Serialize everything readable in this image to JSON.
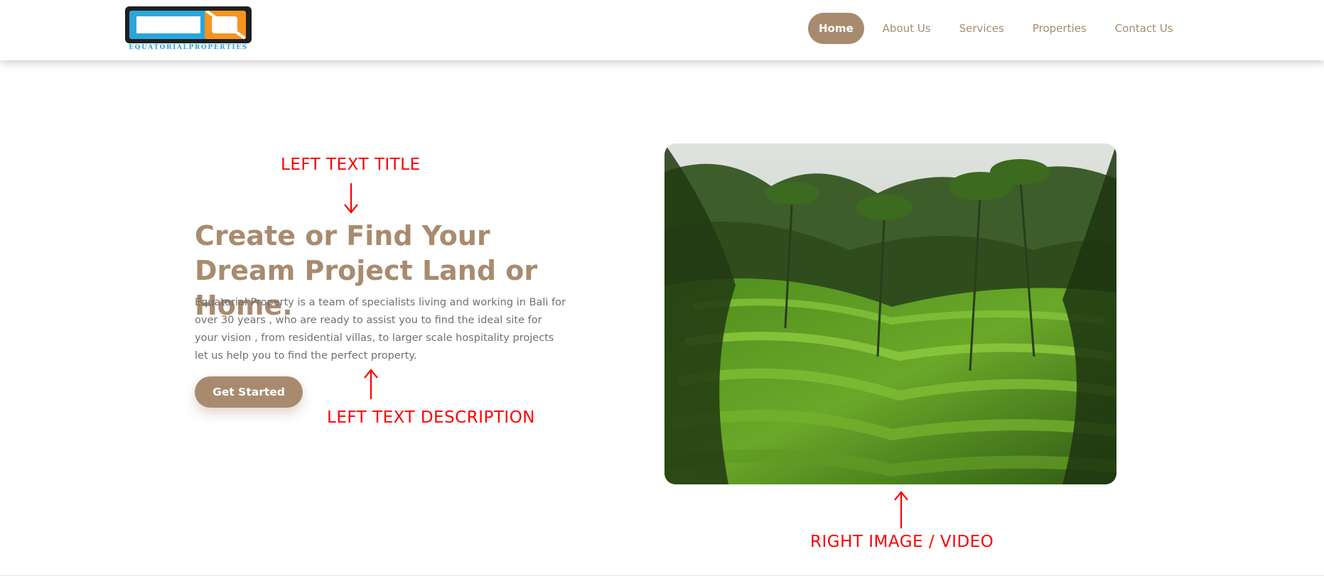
{
  "header": {
    "logo_text": "EQUATORIALPROPERTIES",
    "nav": [
      {
        "label": "Home",
        "active": true
      },
      {
        "label": "About Us",
        "active": false
      },
      {
        "label": "Services",
        "active": false
      },
      {
        "label": "Properties",
        "active": false
      },
      {
        "label": "Contact Us",
        "active": false
      }
    ]
  },
  "hero": {
    "title": "Create or Find Your Dream Project Land or Home.",
    "description": "Equatorial Property is a team of specialists living and working in Bali for over 30 years , who are ready to assist you to find the ideal site for your vision , from residential villas, to larger scale hospitality projects let us help you to find the perfect property.",
    "cta_label": "Get Started",
    "image_icon": "rice-terrace-photo"
  },
  "annotations": {
    "title_label": "LEFT TEXT TITLE",
    "description_label": "LEFT TEXT DESCRIPTION",
    "media_label": "RIGHT IMAGE / VIDEO"
  },
  "colors": {
    "accent": "#a88b6f",
    "annotation": "#ff0000",
    "logo_blue": "#29a6dc",
    "logo_orange": "#f7941d"
  }
}
